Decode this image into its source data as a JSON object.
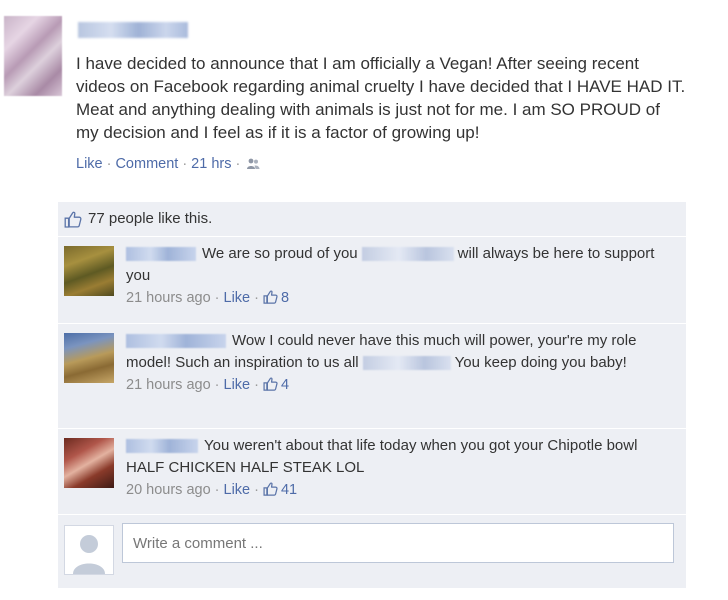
{
  "post": {
    "text": "I have decided to announce that I am officially a Vegan! After seeing recent videos on Facebook regarding animal cruelty I have decided that I HAVE HAD IT. Meat and anything dealing with animals is just not for me. I am SO PROUD of my decision and I feel as if it is a factor of growing up!",
    "like_label": "Like",
    "comment_label": "Comment",
    "time": "21 hrs",
    "audience_icon": "friends-icon"
  },
  "likes": {
    "text": "77 people like this.",
    "icon": "thumbs-up-icon"
  },
  "comments": [
    {
      "text_before": "We are so proud of you",
      "text_after": "will always be here to support you",
      "time": "21 hours ago",
      "like_label": "Like",
      "like_count": "8"
    },
    {
      "text_before": "Wow I could never have this much will power, your're my role model! Such an inspiration to us all",
      "text_after": "You keep doing you baby!",
      "time": "21 hours ago",
      "like_label": "Like",
      "like_count": "4"
    },
    {
      "text_before": "You weren't about that life today when you got your Chipotle bowl HALF CHICKEN HALF STEAK LOL",
      "text_after": "",
      "time": "20 hours ago",
      "like_label": "Like",
      "like_count": "41"
    }
  ],
  "composer": {
    "placeholder": "Write a comment ..."
  },
  "colors": {
    "link": "#4e6ba8",
    "meta": "#8c8c8c",
    "ufi_background": "#edeff4"
  }
}
